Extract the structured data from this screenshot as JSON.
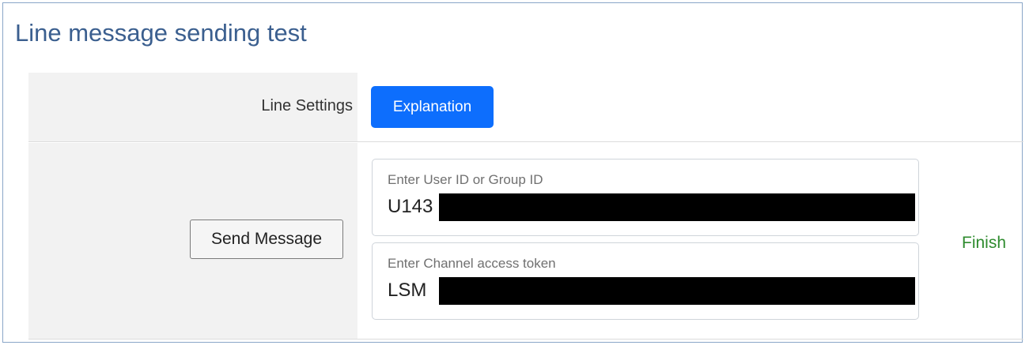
{
  "page": {
    "title": "Line message sending test"
  },
  "settings_row": {
    "label": "Line Settings",
    "explanation_button": "Explanation"
  },
  "send_row": {
    "send_button": "Send Message",
    "user_field": {
      "label": "Enter User ID or Group ID",
      "value": "U143"
    },
    "token_field": {
      "label": "Enter Channel access token",
      "value": "LSM"
    },
    "status": "Finish"
  },
  "colors": {
    "title": "#3b5f8f",
    "primary_button": "#0d6efd",
    "status_success": "#2e8b2e",
    "label_cell_bg": "#f2f2f2",
    "redaction": "#000000"
  }
}
